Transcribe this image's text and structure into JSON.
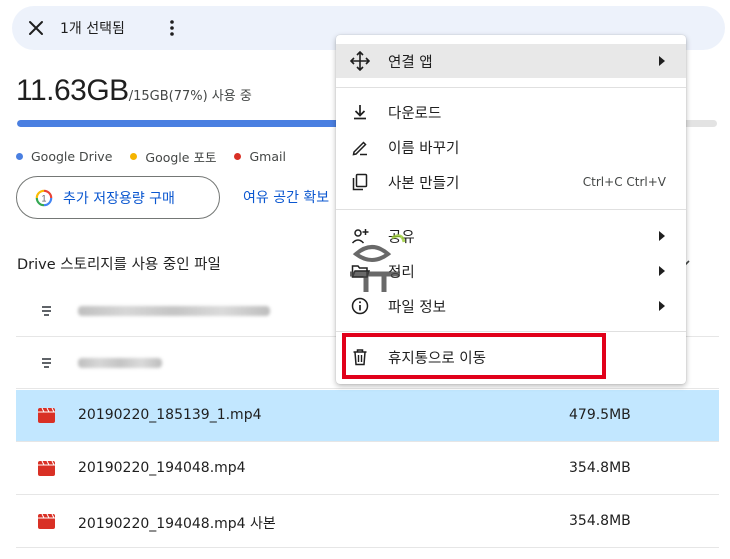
{
  "topbar": {
    "selection_text": "1개 선택됨"
  },
  "storage": {
    "used": "11.63GB",
    "detail": "/15GB(77%) 사용 중",
    "percent": 77
  },
  "legend": [
    {
      "label": "Google Drive",
      "color": "#4a7fe1"
    },
    {
      "label": "Google 포토",
      "color": "#f5b400"
    },
    {
      "label": "Gmail",
      "color": "#d93025"
    }
  ],
  "buttons": {
    "buy": "추가 저장용량 구매",
    "free_space": "여유 공간 확보"
  },
  "section_title": "Drive 스토리지를 사용 중인 파일",
  "files": [
    {
      "name": "",
      "size": "",
      "blurred": true
    },
    {
      "name": "",
      "size": "",
      "blurred": true
    },
    {
      "name": "20190220_185139_1.mp4",
      "size": "479.5MB",
      "selected": true
    },
    {
      "name": "20190220_194048.mp4",
      "size": "354.8MB"
    },
    {
      "name": "20190220_194048.mp4 사본",
      "size": "354.8MB"
    }
  ],
  "menu": {
    "open_with": "연결 앱",
    "download": "다운로드",
    "rename": "이름 바꾸기",
    "make_copy": "사본 만들기",
    "make_copy_shortcut": "Ctrl+C Ctrl+V",
    "share": "공유",
    "organize": "정리",
    "file_info": "파일 정보",
    "trash": "휴지통으로 이동"
  },
  "highlight_color": "#e1001a"
}
